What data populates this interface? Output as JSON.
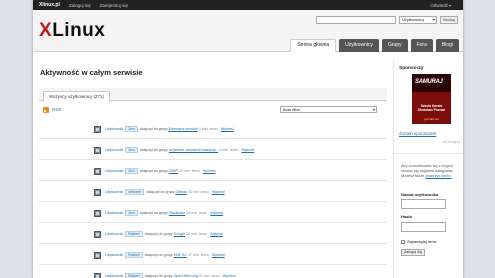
{
  "admin_bar": {
    "site": "Xlinux.pl",
    "login": "Zaloguj się",
    "register": "Zarejestruj się",
    "visit": "Odwiedź"
  },
  "header": {
    "logo_x": "X",
    "logo_rest": "Linux",
    "search_placeholder": "",
    "search_scope": "Użytkownicy",
    "search_button": "Szukaj"
  },
  "nav": {
    "tabs": [
      "Strona główna",
      "Użytkownicy",
      "Grupy",
      "Fora",
      "Blogi"
    ],
    "active": 0
  },
  "main": {
    "title": "Aktywność w całym serwisie",
    "subtab": "Wszyscy użytkownicy (271)",
    "rss": "RSS",
    "filter": "Brak filtra"
  },
  "activity": [
    {
      "user": "Użytkownik",
      "badge": "Zen",
      "action": "dołączył do grupy",
      "group": "Manualne konsole",
      "time": "3 min. temu",
      "del": "Wykreśl"
    },
    {
      "user": "Użytkownik",
      "badge": "Zen",
      "action": "dołączył do grupy",
      "group": "Używanie wirtualnej maszyny...",
      "time": "5 min. temu",
      "del": "Wykreśl"
    },
    {
      "user": "Użytkownik",
      "badge": "Zen",
      "action": "dołączył do grupy",
      "group": "GIMP",
      "time": "20 min. temu",
      "del": "Wykreśl"
    },
    {
      "user": "Użytkownik",
      "badge": "sekkere",
      "action": "dołączył do grupy",
      "group": "Debian",
      "time": "35 min. temu",
      "del": "Wykreśl"
    },
    {
      "user": "Użytkownik",
      "badge": "Zen",
      "action": "dołączył do grupy",
      "group": "Slackware",
      "time": "39 min. temu",
      "del": "Wykreśl"
    },
    {
      "user": "Użytkownik",
      "badge": "Robert",
      "action": "dołączył do grupy",
      "group": "Google",
      "time": "40 min. temu",
      "del": "Wykreśl"
    },
    {
      "user": "Użytkownik",
      "badge": "Robert",
      "action": "dołączył do grupy",
      "group": "KDE SC",
      "time": "47 min. temu",
      "del": "Wykreśl"
    },
    {
      "user": "Użytkownik",
      "badge": "Robert",
      "action": "dołączył do grupy",
      "group": "OpenOffice.org",
      "time": "47 min. temu",
      "del": "Wykreśl"
    }
  ],
  "sidebar": {
    "sponsor_title": "Sponsorzy",
    "banner_title": "SAMURAJ",
    "banner_text": "Szkoła Karate Shotokan Poznań",
    "banner_url": "poznan.net",
    "sponsor_link": "Zostań sponsorem",
    "ad_credit": "AdToday.pl",
    "login_desc": "Aby komunikować się z innymi, musisz się najpierw zalogować. Możesz także",
    "login_desc_link": "utworzyć konto.",
    "username_label": "Nazwa użytkownika",
    "password_label": "Hasło",
    "remember_label": "Zapamiętaj mnie",
    "login_button": "Zaloguj się"
  }
}
